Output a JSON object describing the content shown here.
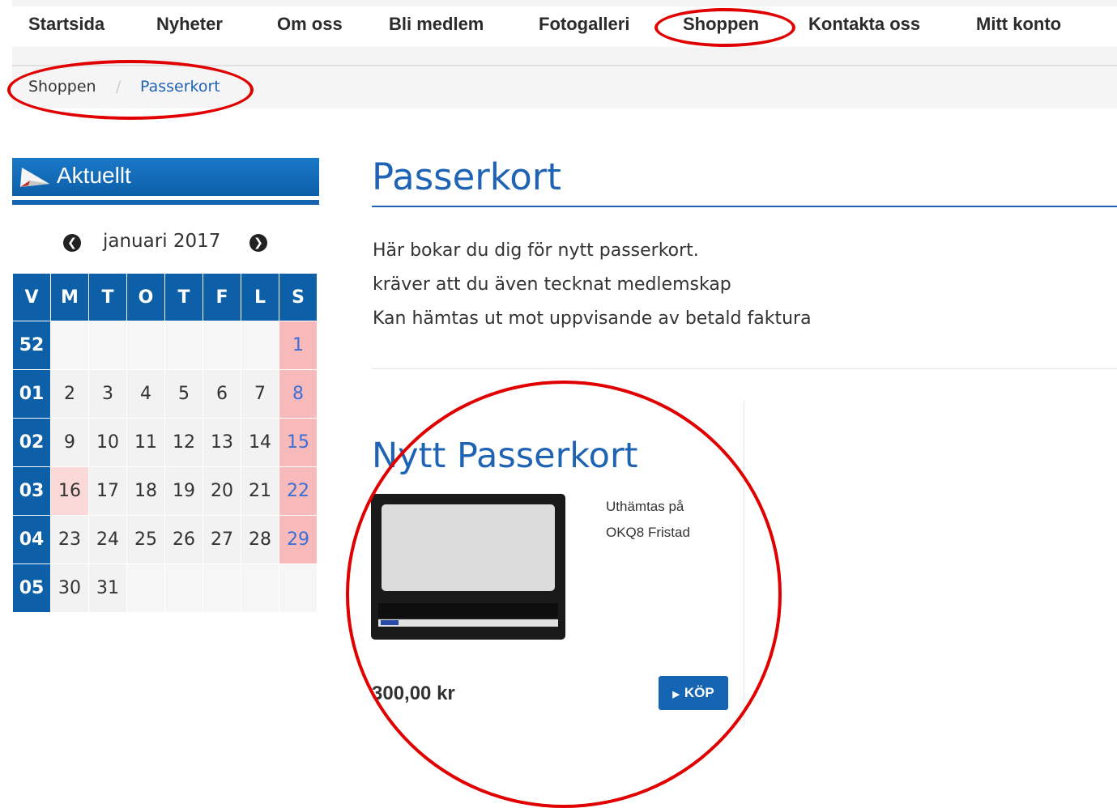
{
  "nav": {
    "items": [
      "Startsida",
      "Nyheter",
      "Om oss",
      "Bli medlem",
      "Fotogalleri",
      "Shoppen",
      "Kontakta oss",
      "Mitt konto"
    ]
  },
  "breadcrumb": {
    "items": [
      "Shoppen",
      "Passerkort"
    ],
    "separator": "/"
  },
  "sidebar": {
    "heading": "Aktuellt",
    "calendar": {
      "month": "januari 2017",
      "headers": [
        "V",
        "M",
        "T",
        "O",
        "T",
        "F",
        "L",
        "S"
      ],
      "weeks": [
        {
          "wk": "52",
          "days": [
            "",
            "",
            "",
            "",
            "",
            "",
            "1"
          ]
        },
        {
          "wk": "01",
          "days": [
            "2",
            "3",
            "4",
            "5",
            "6",
            "7",
            "8"
          ]
        },
        {
          "wk": "02",
          "days": [
            "9",
            "10",
            "11",
            "12",
            "13",
            "14",
            "15"
          ]
        },
        {
          "wk": "03",
          "days": [
            "16",
            "17",
            "18",
            "19",
            "20",
            "21",
            "22"
          ]
        },
        {
          "wk": "04",
          "days": [
            "23",
            "24",
            "25",
            "26",
            "27",
            "28",
            "29"
          ]
        },
        {
          "wk": "05",
          "days": [
            "30",
            "31",
            "",
            "",
            "",
            "",
            ""
          ]
        }
      ],
      "holidays": [
        "16"
      ]
    }
  },
  "main": {
    "title": "Passerkort",
    "intro": [
      "Här bokar du dig för nytt passerkort.",
      "kräver att du även tecknat medlemskap",
      "Kan hämtas ut mot uppvisande av betald faktura"
    ]
  },
  "product": {
    "title": "Nytt Passerkort",
    "description": [
      "Uthämtas på",
      "OKQ8 Fristad"
    ],
    "price": "300,00 kr",
    "buy_label": "KÖP"
  },
  "colors": {
    "accent": "#1f63b5",
    "annotation": "#e00000"
  }
}
